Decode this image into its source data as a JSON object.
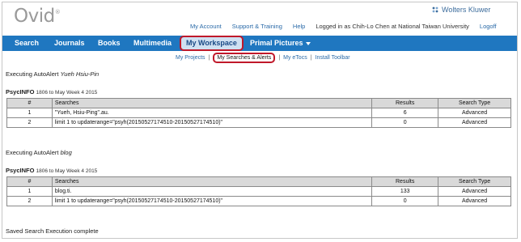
{
  "header": {
    "logo": "Ovid",
    "logo_mark": "®",
    "publisher": "Wolters Kluwer",
    "links": [
      {
        "label": "My Account",
        "interactive": true
      },
      {
        "label": "Support & Training",
        "interactive": true
      },
      {
        "label": "Help",
        "interactive": true
      },
      {
        "label": "Logged in as Chih-Lo Chen at National Taiwan University",
        "interactive": false
      },
      {
        "label": "Logoff",
        "interactive": true
      }
    ]
  },
  "nav": {
    "items": [
      "Search",
      "Journals",
      "Books",
      "Multimedia",
      "My Workspace",
      "Primal Pictures"
    ],
    "active": "My Workspace"
  },
  "subnav": {
    "items": [
      "My Projects",
      "My Searches & Alerts",
      "My eTocs",
      "Install Toolbar"
    ],
    "separators": [
      "|",
      "|",
      "|"
    ],
    "active": "My Searches & Alerts"
  },
  "alerts": [
    {
      "exec_prefix": "Executing AutoAlert",
      "exec_name": "Yueh Hsiu-Pin",
      "database": "PsycINFO",
      "range": "1806 to May Week 4 2015",
      "headers": [
        "#",
        "Searches",
        "Results",
        "Search Type"
      ],
      "rows": [
        {
          "num": "1",
          "search": "\"Yueh, Hsiu-Ping\".au.",
          "results": "6",
          "type": "Advanced"
        },
        {
          "num": "2",
          "search": "limit 1 to updaterange=\"psyh(20150527174510-20150527174510)\"",
          "results": "0",
          "type": "Advanced"
        }
      ]
    },
    {
      "exec_prefix": "Executing AutoAlert",
      "exec_name": "blog",
      "database": "PsycINFO",
      "range": "1806 to May Week 4 2015",
      "headers": [
        "#",
        "Searches",
        "Results",
        "Search Type"
      ],
      "rows": [
        {
          "num": "1",
          "search": "blog.ti.",
          "results": "133",
          "type": "Advanced"
        },
        {
          "num": "2",
          "search": "limit 1 to updaterange=\"psyh(20150527174510-20150527174510)\"",
          "results": "0",
          "type": "Advanced"
        }
      ]
    }
  ],
  "footer_status": "Saved Search Execution complete",
  "colors": {
    "nav_bg": "#1f77c0",
    "highlight_border": "#c0182a",
    "link": "#2a6aa8",
    "table_header_bg": "#d9d9d9"
  }
}
